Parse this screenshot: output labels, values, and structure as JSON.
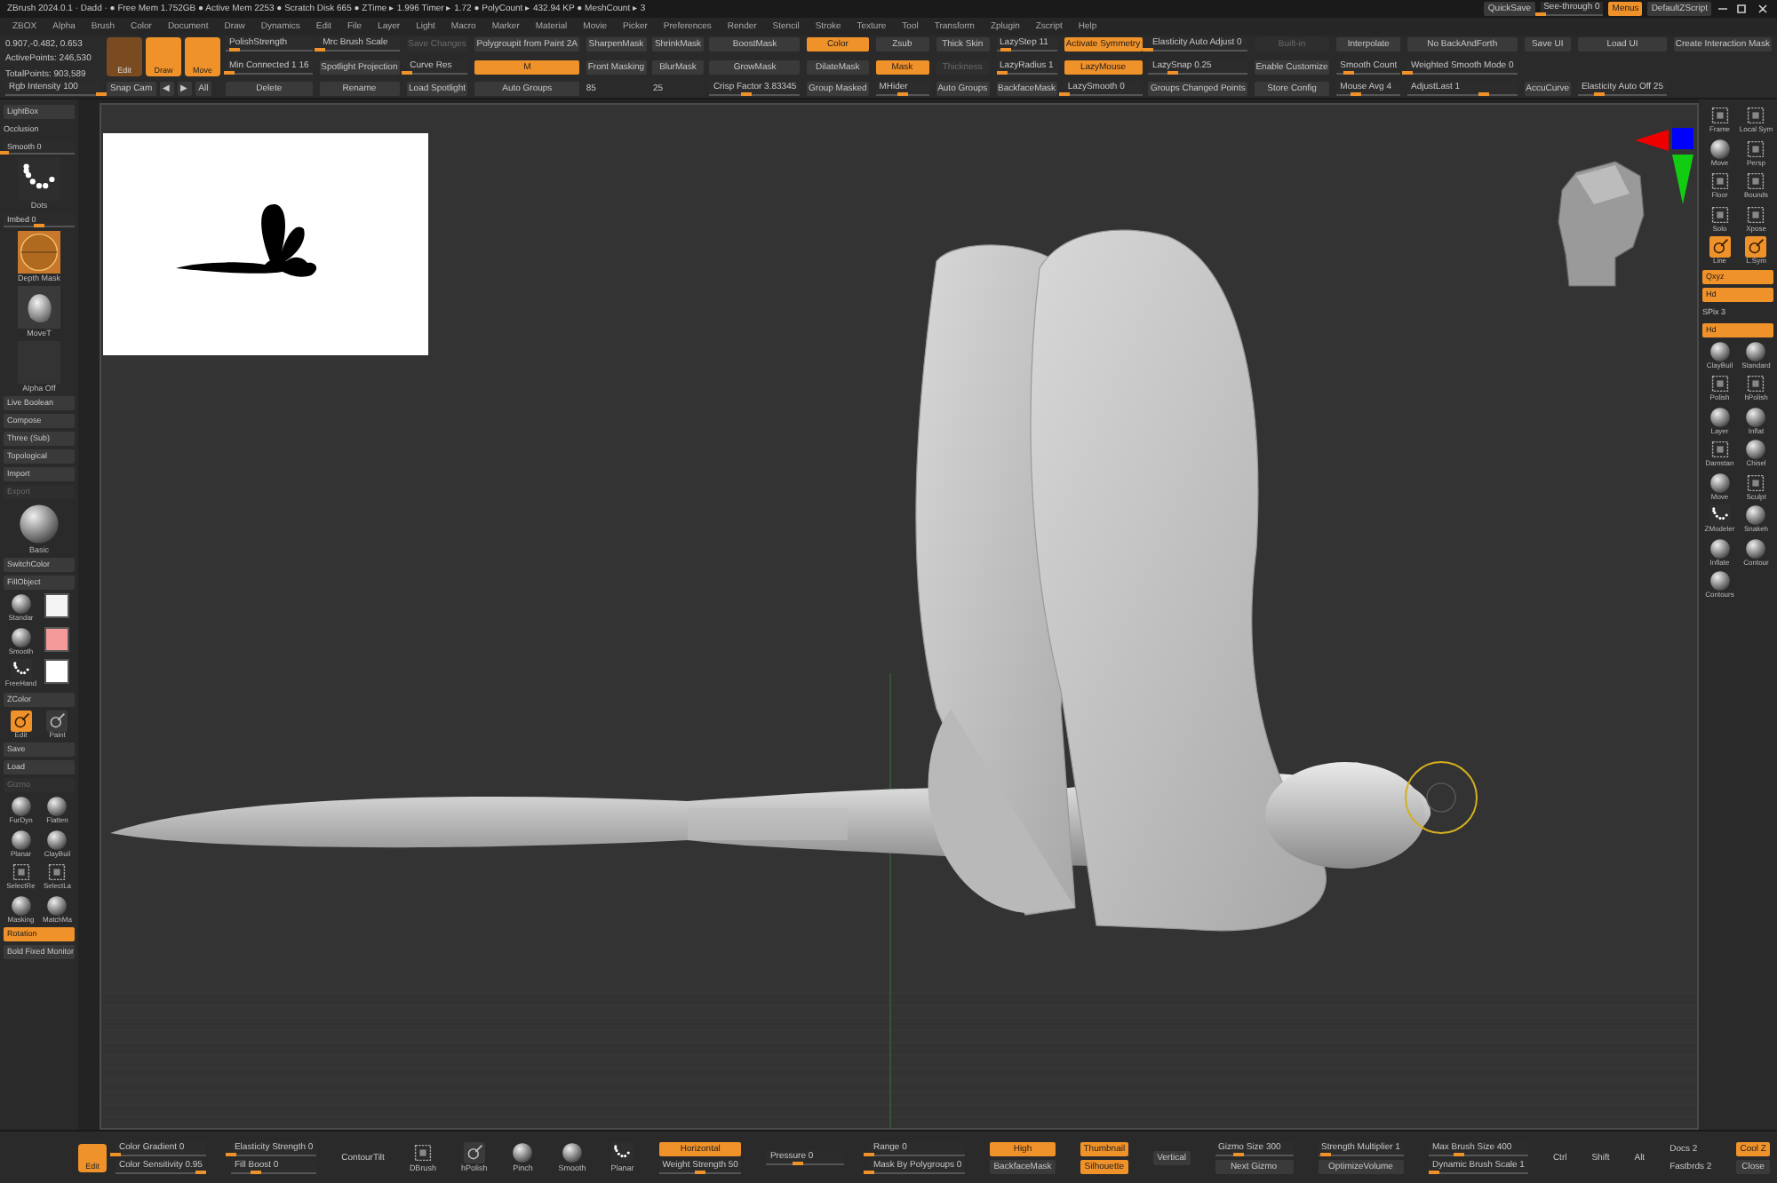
{
  "title": "ZBrush 2024.0.1 · Dadd · ● Free Mem 1.752GB ● Active Mem 2253 ● Scratch Disk 665 ● ZTime ▸ 1.996 Timer ▸ 1.72 ● PolyCount ▸ 432.94 KP ● MeshCount ▸ 3",
  "title_buttons": [
    {
      "kind": "button",
      "label": "QuickSave",
      "on": false,
      "disabled": false
    },
    {
      "kind": "slider",
      "label": "See-through 0",
      "level": 0
    },
    {
      "kind": "button",
      "label": "Menus",
      "on": true,
      "disabled": false
    },
    {
      "kind": "button",
      "label": "DefaultZScript",
      "on": false,
      "disabled": false
    }
  ],
  "menu": [
    "ZBOX",
    "Alpha",
    "Brush",
    "Color",
    "Document",
    "Draw",
    "Dynamics",
    "Edit",
    "File",
    "Layer",
    "Light",
    "Macro",
    "Marker",
    "Material",
    "Movie",
    "Picker",
    "Preferences",
    "Render",
    "Stencil",
    "Stroke",
    "Texture",
    "Tool",
    "Transform",
    "Zplugin",
    "Zscript",
    "Help"
  ],
  "toolbar": {
    "info": [
      "0.907,-0.482, 0.653",
      "ActivePoints: 246,530",
      "TotalPoints: 903,589"
    ],
    "intensity": {
      "kind": "slider",
      "label": "Rgb Intensity 100",
      "level": 1
    },
    "tools": [
      {
        "label": "Edit",
        "on": false
      },
      {
        "label": "Draw",
        "on": true
      },
      {
        "label": "Move",
        "on": true
      }
    ],
    "nav": [
      {
        "kind": "button",
        "label": "Snap Cam",
        "on": false,
        "disabled": false
      },
      {
        "kind": "button",
        "label": "◀",
        "on": false,
        "disabled": false
      },
      {
        "kind": "button",
        "label": "▶",
        "on": false,
        "disabled": false
      },
      {
        "kind": "button",
        "label": "All",
        "on": false,
        "disabled": false
      }
    ],
    "columns": [
      [
        {
          "kind": "slider",
          "label": "PolishStrength",
          "level": 0.1
        },
        {
          "kind": "slider",
          "label": "Min Connected 1 16",
          "level": 0.05
        },
        {
          "kind": "button",
          "label": "Delete",
          "on": false,
          "disabled": false
        }
      ],
      [
        {
          "kind": "slider",
          "label": "Mrc Brush Scale",
          "level": 0
        },
        {
          "kind": "button",
          "label": "Spotlight Projection",
          "on": false,
          "disabled": false
        },
        {
          "kind": "button",
          "label": "Rename",
          "on": false,
          "disabled": false
        }
      ],
      [
        {
          "kind": "button",
          "label": "Save Changes",
          "on": false,
          "disabled": true
        },
        {
          "kind": "slider",
          "label": "Curve Res",
          "level": 0
        },
        {
          "kind": "button",
          "label": "Load Spotlight",
          "on": false,
          "disabled": false
        }
      ],
      [
        {
          "kind": "button",
          "label": "Polygroupit from Paint 2A",
          "on": false,
          "disabled": false
        },
        {
          "kind": "button",
          "label": "M",
          "on": true,
          "disabled": false
        },
        {
          "kind": "button",
          "label": "Auto Groups",
          "on": false,
          "disabled": false
        }
      ],
      [
        {
          "kind": "button",
          "label": "SharpenMask",
          "on": false,
          "disabled": false
        },
        {
          "kind": "button",
          "label": "Front Masking",
          "on": false,
          "disabled": false
        },
        {
          "kind": "text",
          "label": "85"
        }
      ],
      [
        {
          "kind": "button",
          "label": "ShrinkMask",
          "on": false,
          "disabled": false
        },
        {
          "kind": "button",
          "label": "BlurMask",
          "on": false,
          "disabled": false
        },
        {
          "kind": "text",
          "label": "25"
        }
      ],
      [
        {
          "kind": "button",
          "label": "BoostMask",
          "on": false,
          "disabled": false
        },
        {
          "kind": "button",
          "label": "GrowMask",
          "on": false,
          "disabled": false
        },
        {
          "kind": "slider",
          "label": "Crisp Factor 3.83345",
          "level": 0.4
        }
      ],
      [
        {
          "kind": "button",
          "label": "Color",
          "on": true,
          "disabled": false
        },
        {
          "kind": "button",
          "label": "DilateMask",
          "on": false,
          "disabled": false
        },
        {
          "kind": "button",
          "label": "Group Masked",
          "on": false,
          "disabled": false
        }
      ],
      [
        {
          "kind": "button",
          "label": "Zsub",
          "on": false,
          "disabled": false
        },
        {
          "kind": "button",
          "label": "Mask",
          "on": true,
          "disabled": false
        },
        {
          "kind": "slider",
          "label": "MHider",
          "level": 0.5
        }
      ],
      [
        {
          "kind": "button",
          "label": "Thick Skin",
          "on": false,
          "disabled": false
        },
        {
          "kind": "button",
          "label": "Thickness",
          "on": false,
          "disabled": true
        },
        {
          "kind": "button",
          "label": "Auto Groups",
          "on": false,
          "disabled": false
        }
      ],
      [
        {
          "kind": "slider",
          "label": "LazyStep 11",
          "level": 0.15
        },
        {
          "kind": "slider",
          "label": "LazyRadius 1",
          "level": 0.1
        },
        {
          "kind": "button",
          "label": "BackfaceMask",
          "on": false,
          "disabled": false
        }
      ],
      [
        {
          "kind": "button",
          "label": "Activate Symmetry",
          "on": true,
          "disabled": false
        },
        {
          "kind": "button",
          "label": "LazyMouse",
          "on": true,
          "disabled": false
        },
        {
          "kind": "slider",
          "label": "LazySmooth 0",
          "level": 0
        }
      ],
      [
        {
          "kind": "slider",
          "label": "Elasticity Auto Adjust 0",
          "level": 0
        },
        {
          "kind": "slider",
          "label": "LazySnap 0.25",
          "level": 0.25
        },
        {
          "kind": "button",
          "label": "Groups Changed Points",
          "on": false,
          "disabled": false
        }
      ],
      [
        {
          "kind": "button",
          "label": "Built-in",
          "on": false,
          "disabled": true
        },
        {
          "kind": "button",
          "label": "Enable Customize",
          "on": false,
          "disabled": false
        },
        {
          "kind": "button",
          "label": "Store Config",
          "on": false,
          "disabled": false
        }
      ],
      [
        {
          "kind": "button",
          "label": "Interpolate",
          "on": false,
          "disabled": false
        },
        {
          "kind": "slider",
          "label": "Smooth Count",
          "level": 0.2
        },
        {
          "kind": "slider",
          "label": "Mouse Avg 4",
          "level": 0.3
        }
      ],
      [
        {
          "kind": "button",
          "label": "No BackAndForth",
          "on": false,
          "disabled": false
        },
        {
          "kind": "slider",
          "label": "Weighted Smooth Mode 0",
          "level": 0
        },
        {
          "kind": "slider",
          "label": "AdjustLast 1",
          "level": 0.7
        }
      ],
      [
        {
          "kind": "button",
          "label": "Save UI",
          "on": false,
          "disabled": false
        },
        {
          "kind": "button",
          "label": "AccuCurve",
          "on": false,
          "disabled": false
        }
      ],
      [
        {
          "kind": "button",
          "label": "Load UI",
          "on": false,
          "disabled": false
        },
        {
          "kind": "slider",
          "label": "Elasticity Auto Off 25",
          "level": 0.25
        }
      ],
      [
        {
          "kind": "button",
          "label": "Create Interaction Mask",
          "on": false,
          "disabled": false
        }
      ]
    ]
  },
  "left_shelf": [
    {
      "kind": "button",
      "label": "LightBox",
      "on": false,
      "disabled": false
    },
    {
      "kind": "text",
      "label": "Occlusion"
    },
    {
      "kind": "slider",
      "label": "Smooth 0",
      "level": 0
    },
    {
      "kind": "stroke",
      "label": "Dots"
    },
    {
      "kind": "slider",
      "label": "Imbed 0",
      "level": 0.5
    },
    {
      "kind": "alpha",
      "label": "Depth Mask"
    },
    {
      "kind": "blob",
      "label": "MoveT"
    },
    {
      "kind": "blank",
      "label": "Alpha Off"
    },
    {
      "kind": "button",
      "label": "Live Boolean",
      "on": false,
      "disabled": false
    },
    {
      "kind": "button",
      "label": "Compose",
      "on": false,
      "disabled": false
    },
    {
      "kind": "button",
      "label": "Three (Sub)",
      "on": false,
      "disabled": false
    },
    {
      "kind": "button",
      "label": "Topological",
      "on": false,
      "disabled": false
    },
    {
      "kind": "button",
      "label": "Import",
      "on": false,
      "disabled": false
    },
    {
      "kind": "button",
      "label": "Export",
      "on": false,
      "disabled": true
    },
    {
      "kind": "material",
      "label": "Basic"
    },
    {
      "kind": "button",
      "label": "SwitchColor",
      "on": false,
      "disabled": false
    },
    {
      "kind": "button",
      "label": "FillObject",
      "on": false,
      "disabled": false
    },
    {
      "kind": "sphere",
      "label": "Standar"
    },
    {
      "kind": "swatch",
      "color": "#f4f4f4"
    },
    {
      "kind": "sphere",
      "label": "Smooth"
    },
    {
      "kind": "swatch",
      "color": "#f49a9a"
    },
    {
      "kind": "dots",
      "label": "FreeHand"
    },
    {
      "kind": "swatch",
      "color": "#ffffff"
    },
    {
      "kind": "button",
      "label": "ZColor",
      "on": false,
      "disabled": false
    },
    {
      "kind": "brush",
      "label": "Edit",
      "on": true
    },
    {
      "kind": "brush",
      "label": "Paint",
      "on": false
    },
    {
      "kind": "button",
      "label": "Save",
      "on": false,
      "disabled": false
    },
    {
      "kind": "button",
      "label": "Load",
      "on": false,
      "disabled": false
    },
    {
      "kind": "button",
      "label": "Gizmo",
      "on": false,
      "disabled": true
    },
    {
      "kind": "sphere",
      "label": "FurDyn"
    },
    {
      "kind": "sphere",
      "label": "Flatten"
    },
    {
      "kind": "sphere",
      "label": "Planar"
    },
    {
      "kind": "sphere",
      "label": "ClayBuil"
    },
    {
      "kind": "frame",
      "label": "SelectRe"
    },
    {
      "kind": "frame",
      "label": "SelectLa"
    },
    {
      "kind": "sphere",
      "label": "Masking"
    },
    {
      "kind": "sphere",
      "label": "MatchMa"
    },
    {
      "kind": "button",
      "label": "Rotation",
      "on": true,
      "disabled": false
    },
    {
      "kind": "button",
      "label": "Bold Fixed Monitor",
      "on": false,
      "disabled": false
    }
  ],
  "right_shelf": [
    {
      "kind": "frame",
      "label": "Frame"
    },
    {
      "kind": "frame",
      "label": "Local Sym"
    },
    {
      "kind": "sphere",
      "label": "Move"
    },
    {
      "kind": "frame",
      "label": "Persp"
    },
    {
      "kind": "frame",
      "label": "Floor"
    },
    {
      "kind": "frame",
      "label": "Bounds"
    },
    {
      "kind": "frame",
      "label": "Solo"
    },
    {
      "kind": "frame",
      "label": "Xpose"
    },
    {
      "kind": "brush",
      "label": "Line",
      "on": true
    },
    {
      "kind": "brush",
      "label": "L.Sym",
      "on": true
    },
    {
      "kind": "button",
      "label": "Qxyz",
      "on": true,
      "disabled": false
    },
    {
      "kind": "button",
      "label": "Hd",
      "on": true,
      "disabled": false
    },
    {
      "kind": "text",
      "label": "SPix 3"
    },
    {
      "kind": "button",
      "label": "Hd",
      "on": true,
      "disabled": false
    },
    {
      "kind": "sphere",
      "label": "ClayBuil"
    },
    {
      "kind": "sphere",
      "label": "Standard"
    },
    {
      "kind": "frame",
      "label": "Polish"
    },
    {
      "kind": "frame",
      "label": "hPolish"
    },
    {
      "kind": "sphere",
      "label": "Layer"
    },
    {
      "kind": "sphere",
      "label": "Inflat"
    },
    {
      "kind": "frame",
      "label": "Damstan"
    },
    {
      "kind": "sphere",
      "label": "Chisel"
    },
    {
      "kind": "sphere",
      "label": "Move"
    },
    {
      "kind": "frame",
      "label": "Sculpt"
    },
    {
      "kind": "dots",
      "label": "ZModeler"
    },
    {
      "kind": "sphere",
      "label": "Snakeh"
    },
    {
      "kind": "sphere",
      "label": "Inflate"
    },
    {
      "kind": "sphere",
      "label": "Contour"
    },
    {
      "kind": "sphere",
      "label": "Contours"
    }
  ],
  "bottom": {
    "tool": {
      "label": "Edit",
      "on": true
    },
    "columns": [
      [
        {
          "kind": "slider",
          "label": "Color Gradient 0",
          "level": 0
        },
        {
          "kind": "slider",
          "label": "Color Sensitivity 0.95",
          "level": 0.95
        }
      ],
      [
        {
          "kind": "slider",
          "label": "Elasticity Strength 0",
          "level": 0
        },
        {
          "kind": "slider",
          "label": "Fill Boost 0",
          "level": 0.3
        }
      ],
      [
        {
          "kind": "text",
          "label": "ContourTilt"
        }
      ],
      [
        {
          "kind": "frame",
          "label": "DBrush"
        }
      ],
      [
        {
          "kind": "brush",
          "label": "hPolish",
          "on": false
        }
      ],
      [
        {
          "kind": "sphere",
          "label": "Pinch"
        }
      ],
      [
        {
          "kind": "sphere",
          "label": "Smooth"
        }
      ],
      [
        {
          "kind": "dots",
          "label": "Planar"
        }
      ],
      [
        {
          "kind": "button",
          "label": "Horizontal",
          "on": true,
          "disabled": false
        },
        {
          "kind": "slider",
          "label": "Weight Strength 50",
          "level": 0.5
        }
      ],
      [
        {
          "kind": "slider",
          "label": "Pressure 0",
          "level": 0.4
        }
      ],
      [
        {
          "kind": "slider",
          "label": "Range 0",
          "level": 0
        },
        {
          "kind": "slider",
          "label": "Mask By Polygroups 0",
          "level": 0
        }
      ],
      [
        {
          "kind": "button",
          "label": "High",
          "on": true,
          "disabled": false
        },
        {
          "kind": "button",
          "label": "BackfaceMask",
          "on": false,
          "disabled": false
        }
      ],
      [
        {
          "kind": "button",
          "label": "Thumbnail",
          "on": true,
          "disabled": false
        },
        {
          "kind": "button",
          "label": "Silhouette",
          "on": true,
          "disabled": false
        }
      ],
      [
        {
          "kind": "button",
          "label": "Vertical",
          "on": false,
          "disabled": false
        }
      ],
      [
        {
          "kind": "slider",
          "label": "Gizmo Size 300",
          "level": 0.3
        },
        {
          "kind": "button",
          "label": "Next Gizmo",
          "on": false,
          "disabled": false
        }
      ],
      [
        {
          "kind": "slider",
          "label": "Strength Multiplier 1",
          "level": 0.1
        },
        {
          "kind": "button",
          "label": "OptimizeVolume",
          "on": false,
          "disabled": false
        }
      ],
      [
        {
          "kind": "slider",
          "label": "Max Brush Size 400",
          "level": 0.3
        },
        {
          "kind": "slider",
          "label": "Dynamic Brush Scale 1",
          "level": 0.05
        }
      ],
      [
        {
          "kind": "text",
          "label": "Ctrl"
        }
      ],
      [
        {
          "kind": "text",
          "label": "Shift"
        }
      ],
      [
        {
          "kind": "text",
          "label": "Alt"
        }
      ],
      [
        {
          "kind": "text",
          "label": "Docs 2"
        },
        {
          "kind": "text",
          "label": "Fastbrds 2"
        }
      ],
      [
        {
          "kind": "button",
          "label": "Cool Z",
          "on": true,
          "disabled": false
        },
        {
          "kind": "button",
          "label": "Close",
          "on": false,
          "disabled": false
        }
      ]
    ]
  }
}
